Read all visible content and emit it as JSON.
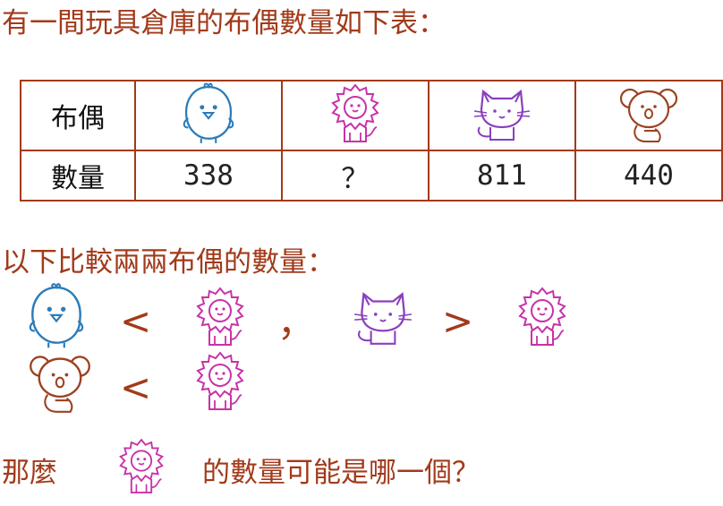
{
  "heading": "有一間玩具倉庫的布偶數量如下表：",
  "table": {
    "row_labels": [
      "布偶",
      "數量"
    ],
    "columns": [
      {
        "icon": "blue-bird-icon",
        "count": "338"
      },
      {
        "icon": "pink-lion-icon",
        "count": "？"
      },
      {
        "icon": "purple-cat-icon",
        "count": "811"
      },
      {
        "icon": "brown-koala-icon",
        "count": "440"
      }
    ]
  },
  "compare_title": "以下比較兩兩布偶的數量：",
  "comparisons": {
    "symbol_less_1": "<",
    "separator": "，",
    "symbol_greater": ">",
    "symbol_less_2": "<"
  },
  "question": {
    "before_icon": "那麼",
    "after_icon": "的數量可能是哪一個？"
  },
  "colors": {
    "text": "#a23a1a",
    "bird": "#2c7cb8",
    "lion": "#c832a8",
    "cat": "#8a3fbf",
    "koala": "#9c4222"
  }
}
